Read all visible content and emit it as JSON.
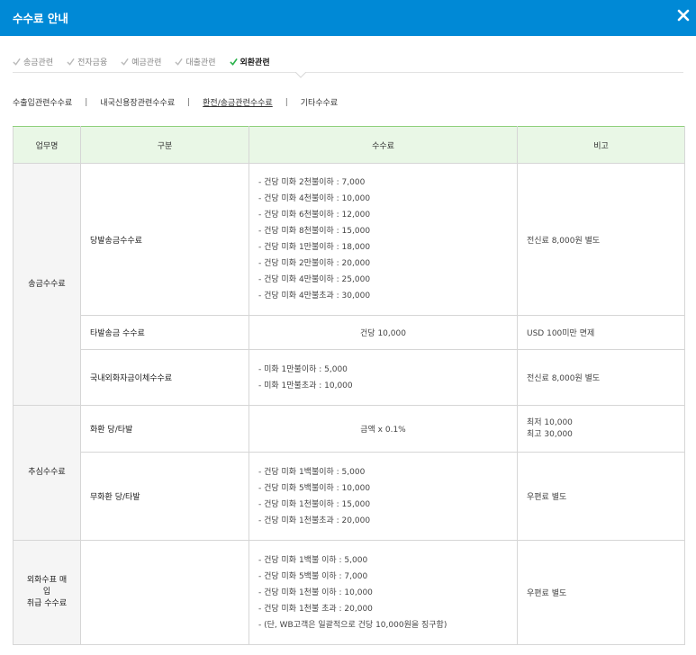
{
  "window": {
    "title": "수수료 안내",
    "close_icon": "close-icon"
  },
  "tabs": [
    {
      "label": "송금관련",
      "active": false
    },
    {
      "label": "전자금융",
      "active": false
    },
    {
      "label": "예금관련",
      "active": false
    },
    {
      "label": "대출관련",
      "active": false
    },
    {
      "label": "외환관련",
      "active": true
    }
  ],
  "subnav": {
    "items": [
      "수출입관련수수료",
      "내국신용장관련수수료",
      "환전/송금관련수수료",
      "기타수수료"
    ],
    "separator": "|",
    "active_index": 2
  },
  "table": {
    "headers": [
      "업무명",
      "구분",
      "수수료",
      "비고"
    ],
    "groups": [
      {
        "category": "송금수수료",
        "rows": [
          {
            "type": "당발송금수수료",
            "fee": [
              "- 건당 미화 2천불이하 : 7,000",
              "- 건당 미화 4천불이하 : 10,000",
              "- 건당 미화 6천불이하 : 12,000",
              "- 건당 미화 8천불이하 : 15,000",
              "- 건당 미화 1만불이하 : 18,000",
              "- 건당 미화 2만불이하 : 20,000",
              "- 건당 미화 4만불이하 : 25,000",
              "- 건당 미화 4만불초과 : 30,000"
            ],
            "note": [
              "전신료 8,000원 별도"
            ]
          },
          {
            "type": "타발송금 수수료",
            "fee": [
              "건당 10,000"
            ],
            "note": [
              "USD 100미만 면제"
            ]
          },
          {
            "type": "국내외화자금이체수수료",
            "fee": [
              "- 미화 1만불이하 : 5,000",
              "- 미화 1만불초과 : 10,000"
            ],
            "note": [
              "전신료 8,000원 별도"
            ]
          }
        ]
      },
      {
        "category": "추심수수료",
        "rows": [
          {
            "type": "화환 당/타발",
            "fee": [
              "금액 x 0.1%"
            ],
            "note": [
              "최저 10,000",
              "최고 30,000"
            ]
          },
          {
            "type": "무화환 당/타발",
            "fee": [
              "- 건당 미화 1백불이하 : 5,000",
              "- 건당 미화 5백불이하 : 10,000",
              "- 건당 미화 1천불이하 : 15,000",
              "- 건당 미화 1천불초과 : 20,000"
            ],
            "note": [
              "우편료 별도"
            ]
          }
        ]
      },
      {
        "category_lines": [
          "외화수표 매",
          "입",
          "취급 수수료"
        ],
        "rows": [
          {
            "type": "",
            "fee": [
              "- 건당 미화 1백불 이하 : 5,000",
              "- 건당 미화 5백불 이하 : 7,000",
              "- 건당 미화 1천불 이하 : 10,000",
              "- 건당 미화 1천불 초과 : 20,000",
              "- (단, WB고객은 일괄적으로 건당 10,000원을 징구함)"
            ],
            "note": [
              "우편료 별도"
            ]
          }
        ]
      }
    ]
  },
  "colors": {
    "titlebar": "#0089d6",
    "check_active": "#2bb24c",
    "check_inactive": "#bbbbbb",
    "header_bg": "#e9f7e6",
    "category_bg": "#f5f5f5"
  }
}
